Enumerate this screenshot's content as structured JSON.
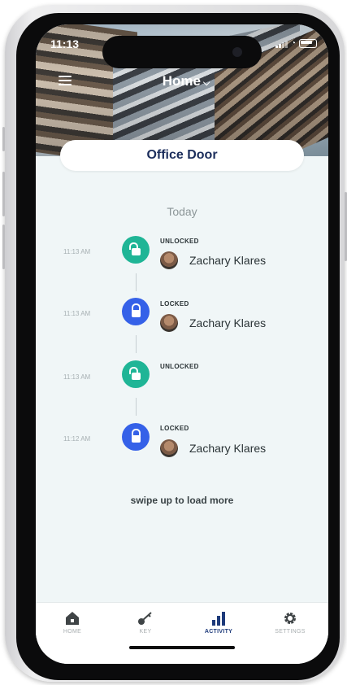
{
  "status_bar": {
    "time": "11:13"
  },
  "header": {
    "title": "Home"
  },
  "door": {
    "name": "Office Door"
  },
  "activity": {
    "section_title": "Today",
    "events": [
      {
        "time": "11:13 AM",
        "status": "UNLOCKED",
        "user": "Zachary Klares",
        "color": "#1fb596"
      },
      {
        "time": "11:13 AM",
        "status": "LOCKED",
        "user": "Zachary Klares",
        "color": "#3561e8"
      },
      {
        "time": "11:13 AM",
        "status": "UNLOCKED",
        "user": "",
        "color": "#1fb596"
      },
      {
        "time": "11:12 AM",
        "status": "LOCKED",
        "user": "Zachary Klares",
        "color": "#3561e8"
      }
    ],
    "load_more": "swipe up to load more"
  },
  "tabbar": {
    "items": [
      {
        "label": "HOME",
        "icon": "home-icon"
      },
      {
        "label": "KEY",
        "icon": "key-icon"
      },
      {
        "label": "ACTIVITY",
        "icon": "bar-chart-icon",
        "active": true
      },
      {
        "label": "SETTINGS",
        "icon": "gear-icon"
      }
    ]
  }
}
